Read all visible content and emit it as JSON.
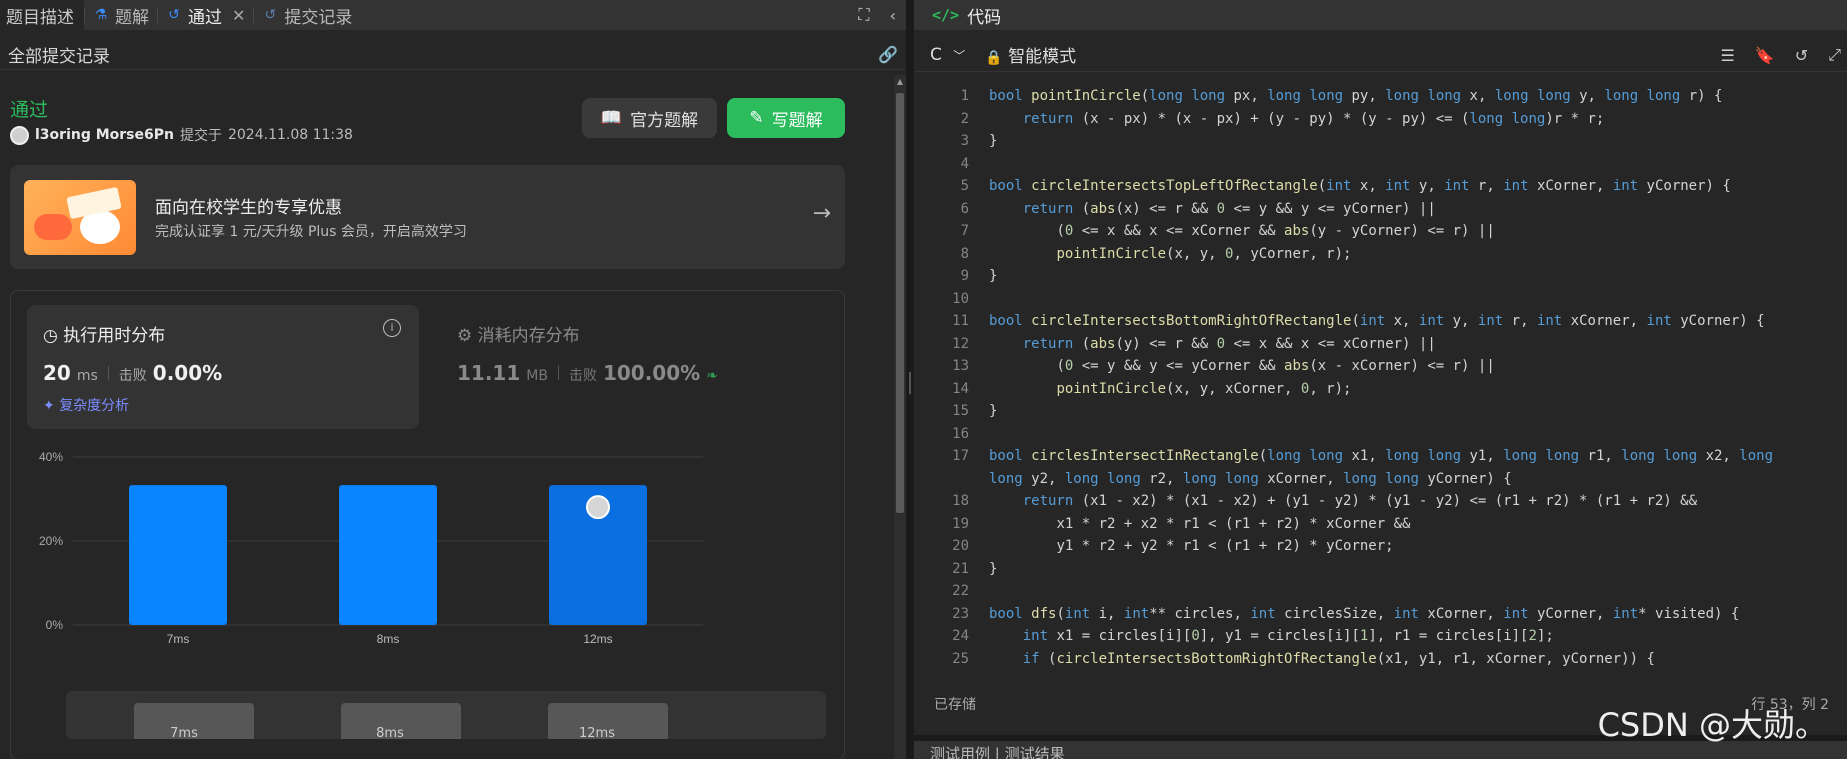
{
  "left_tabs": [
    {
      "label": "题目描述",
      "icon": "file-icon"
    },
    {
      "label": "题解",
      "icon": "flask-icon"
    },
    {
      "label": "通过",
      "icon": "history-icon",
      "active": true
    },
    {
      "label": "提交记录",
      "icon": "history-icon"
    }
  ],
  "left_tools": {
    "fullscreen_icon": "⛶",
    "collapse_icon": "‹"
  },
  "sub_header": {
    "title": "全部提交记录",
    "link_icon": "🔗"
  },
  "submission": {
    "status": "通过",
    "user": "l3oring Morse6Pn",
    "submitted_prefix": "提交于",
    "submitted_at": "2024.11.08 11:38",
    "official_button": "官方题解",
    "write_button": "写题解"
  },
  "promo": {
    "title": "面向在校学生的专享优惠",
    "desc": "完成认证享 1 元/天升级 Plus 会员，开启高效学习",
    "arrow": "→"
  },
  "runtime": {
    "label": "执行用时分布",
    "value": "20",
    "unit": "ms",
    "beat_label": "击败",
    "beat_value": "0.00%",
    "complexity_link": "复杂度分析",
    "info_icon": "i"
  },
  "memory": {
    "label": "消耗内存分布",
    "value": "11.11",
    "unit": "MB",
    "beat_label": "击败",
    "beat_value": "100.00%"
  },
  "chart_data": {
    "type": "bar",
    "categories": [
      "7ms",
      "8ms",
      "12ms"
    ],
    "values": [
      33.3,
      33.3,
      33.3
    ],
    "highlight_index": 2,
    "ylim": [
      0,
      40
    ],
    "yticks": [
      "0%",
      "20%",
      "40%"
    ],
    "ytick_values": [
      0,
      20,
      40
    ],
    "colors": {
      "bar": "#0a84ff",
      "highlight": "#0a6fe0",
      "grid": "#3f3f3f"
    }
  },
  "mini_chart": {
    "labels": [
      "7ms",
      "8ms",
      "12ms"
    ]
  },
  "editor": {
    "tab_label": "代码",
    "language": "C",
    "mode": "智能模式",
    "saved": "已存储",
    "cursor": "行 53，列 2"
  },
  "code_lines": [
    {
      "n": "1",
      "t": "bool pointInCircle(long long px, long long py, long long x, long long y, long long r) {"
    },
    {
      "n": "2",
      "t": "    return (x - px) * (x - px) + (y - py) * (y - py) <= (long long)r * r;"
    },
    {
      "n": "3",
      "t": "}"
    },
    {
      "n": "4",
      "t": ""
    },
    {
      "n": "5",
      "t": "bool circleIntersectsTopLeftOfRectangle(int x, int y, int r, int xCorner, int yCorner) {"
    },
    {
      "n": "6",
      "t": "    return (abs(x) <= r && 0 <= y && y <= yCorner) ||"
    },
    {
      "n": "7",
      "t": "        (0 <= x && x <= xCorner && abs(y - yCorner) <= r) ||"
    },
    {
      "n": "8",
      "t": "        pointInCircle(x, y, 0, yCorner, r);"
    },
    {
      "n": "9",
      "t": "}"
    },
    {
      "n": "10",
      "t": ""
    },
    {
      "n": "11",
      "t": "bool circleIntersectsBottomRightOfRectangle(int x, int y, int r, int xCorner, int yCorner) {"
    },
    {
      "n": "12",
      "t": "    return (abs(y) <= r && 0 <= x && x <= xCorner) ||"
    },
    {
      "n": "13",
      "t": "        (0 <= y && y <= yCorner && abs(x - xCorner) <= r) ||"
    },
    {
      "n": "14",
      "t": "        pointInCircle(x, y, xCorner, 0, r);"
    },
    {
      "n": "15",
      "t": "}"
    },
    {
      "n": "16",
      "t": ""
    },
    {
      "n": "17",
      "t": "bool circlesIntersectInRectangle(long long x1, long long y1, long long r1, long long x2, long\nlong y2, long long r2, long long xCorner, long long yCorner) {",
      "wrap": true
    },
    {
      "n": "18",
      "t": "    return (x1 - x2) * (x1 - x2) + (y1 - y2) * (y1 - y2) <= (r1 + r2) * (r1 + r2) &&"
    },
    {
      "n": "19",
      "t": "        x1 * r2 + x2 * r1 < (r1 + r2) * xCorner &&"
    },
    {
      "n": "20",
      "t": "        y1 * r2 + y2 * r1 < (r1 + r2) * yCorner;"
    },
    {
      "n": "21",
      "t": "}"
    },
    {
      "n": "22",
      "t": ""
    },
    {
      "n": "23",
      "t": "bool dfs(int i, int** circles, int circlesSize, int xCorner, int yCorner, int* visited) {"
    },
    {
      "n": "24",
      "t": "    int x1 = circles[i][0], y1 = circles[i][1], r1 = circles[i][2];"
    },
    {
      "n": "25",
      "t": "    if (circleIntersectsBottomRightOfRectangle(x1, y1, r1, xCorner, yCorner)) {"
    }
  ],
  "syntax_colors": {
    "keyword": "#569cd6",
    "function": "#dcdcaa",
    "number": "#b5cea8",
    "default": "#d4d4d4"
  },
  "bottom_strip": {
    "label": "测试用例 | 测试结果"
  },
  "watermark": "CSDN @大勋。"
}
